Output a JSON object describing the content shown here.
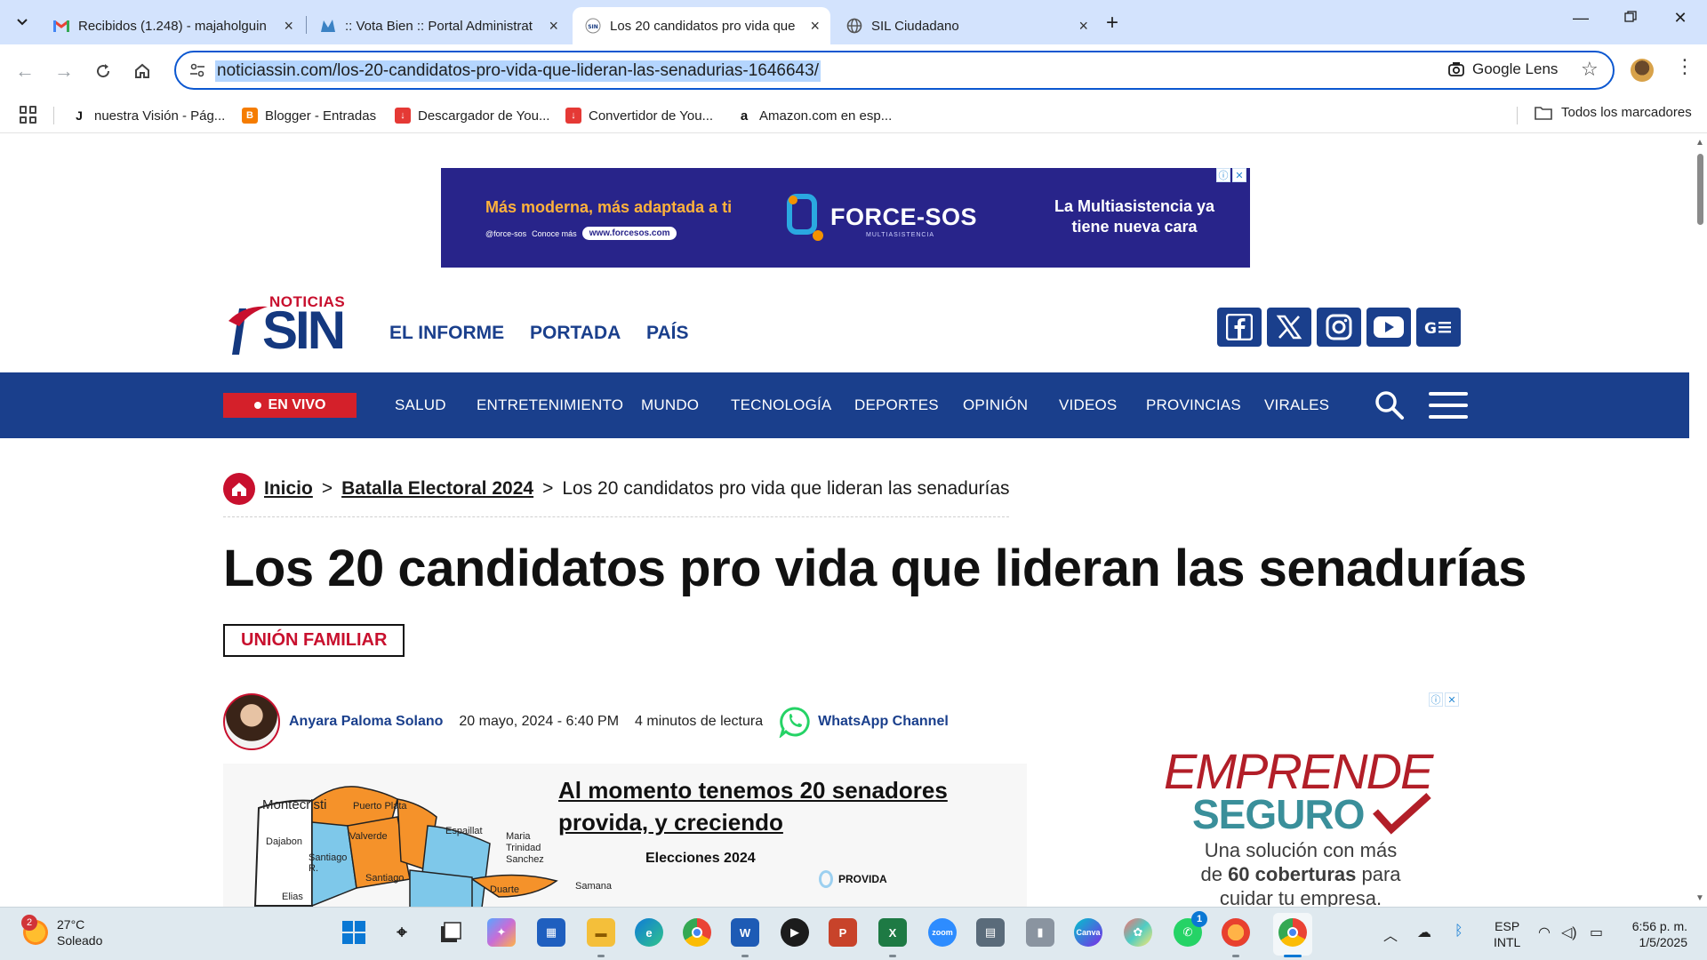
{
  "browser": {
    "tabs": [
      {
        "title": "Recibidos (1.248) - majaholguin",
        "icon": "gmail-icon"
      },
      {
        "title": ":: Vota Bien :: Portal Administrat",
        "icon": "votabien-icon"
      },
      {
        "title": "Los 20 candidatos pro vida que",
        "icon": "sin-icon",
        "active": true
      },
      {
        "title": "SIL Ciudadano",
        "icon": "globe-icon"
      }
    ],
    "url": "noticiassin.com/los-20-candidatos-pro-vida-que-lideran-las-senadurias-1646643/",
    "lens_label": "Google Lens",
    "bookmarks": [
      {
        "label": "nuestra Visión - Pág...",
        "icon": "J",
        "color": "#ffffff"
      },
      {
        "label": "Blogger - Entradas",
        "icon": "B",
        "color": "#f57c00"
      },
      {
        "label": "Descargador de You...",
        "icon": "↓",
        "color": "#e53935"
      },
      {
        "label": "Convertidor de You...",
        "icon": "↓",
        "color": "#e53935"
      },
      {
        "label": "Amazon.com en esp...",
        "icon": "a",
        "color": "#ffffff"
      }
    ],
    "all_bookmarks": "Todos los marcadores"
  },
  "ad_top": {
    "left": "Más moderna, más adaptada a ti",
    "handle": "@force-sos",
    "cta": "Conoce más",
    "web": "www.forcesos.com",
    "brand": "FORCE-SOS",
    "brand_sub": "MULTIASISTENCIA",
    "right": "La Multiasistencia ya tiene nueva cara"
  },
  "header": {
    "logo_top": "NOTICIAS",
    "logo_main": "SIN",
    "nav": [
      "EL INFORME",
      "PORTADA",
      "PAÍS"
    ],
    "social": [
      "facebook-icon",
      "x-icon",
      "instagram-icon",
      "youtube-icon",
      "google-news-icon"
    ]
  },
  "main_nav": {
    "live": "EN VIVO",
    "items": [
      "SALUD",
      "ENTRETENIMIENTO",
      "MUNDO",
      "TECNOLOGÍA",
      "DEPORTES",
      "OPINIÓN",
      "VIDEOS",
      "PROVINCIAS",
      "VIRALES"
    ]
  },
  "breadcrumb": {
    "home": "Inicio",
    "section": "Batalla Electoral 2024",
    "current": "Los 20 candidatos pro vida que lideran las senadurías",
    "sep": ">"
  },
  "article": {
    "title": "Los 20 candidatos pro vida que lideran las senadurías",
    "category": "UNIÓN FAMILIAR",
    "author": "Anyara Paloma Solano",
    "date": "20 mayo, 2024 - 6:40 PM",
    "read_time": "4 minutos de lectura",
    "whatsapp": "WhatsApp Channel",
    "image": {
      "heading_1": "Al momento tenemos 20 senadores",
      "heading_2": "provida, y creciendo",
      "subheading": "Elecciones 2024",
      "legend": "PROVIDA",
      "provinces": [
        "Montecristi",
        "Puerto Plata",
        "Dajabon",
        "Valverde",
        "Espaillat",
        "Maria Trinidad Sanchez",
        "Santiago R.",
        "Santiago",
        "Duarte",
        "Samana",
        "Elias"
      ]
    }
  },
  "ad_side": {
    "line1": "EMPRENDE",
    "line2": "SEGURO",
    "text1": "Una solución con más",
    "text2a": "de ",
    "text2b": "60 coberturas",
    "text2c": " para",
    "text3": "cuidar tu empresa."
  },
  "taskbar": {
    "weather_badge": "2",
    "temp": "27°C",
    "condition": "Soleado",
    "lang1": "ESP",
    "lang2": "INTL",
    "time": "6:56 p. m.",
    "date": "1/5/2025",
    "whatsapp_badge": "1",
    "zoom_label": "zoom",
    "canva_label": "Canva"
  }
}
